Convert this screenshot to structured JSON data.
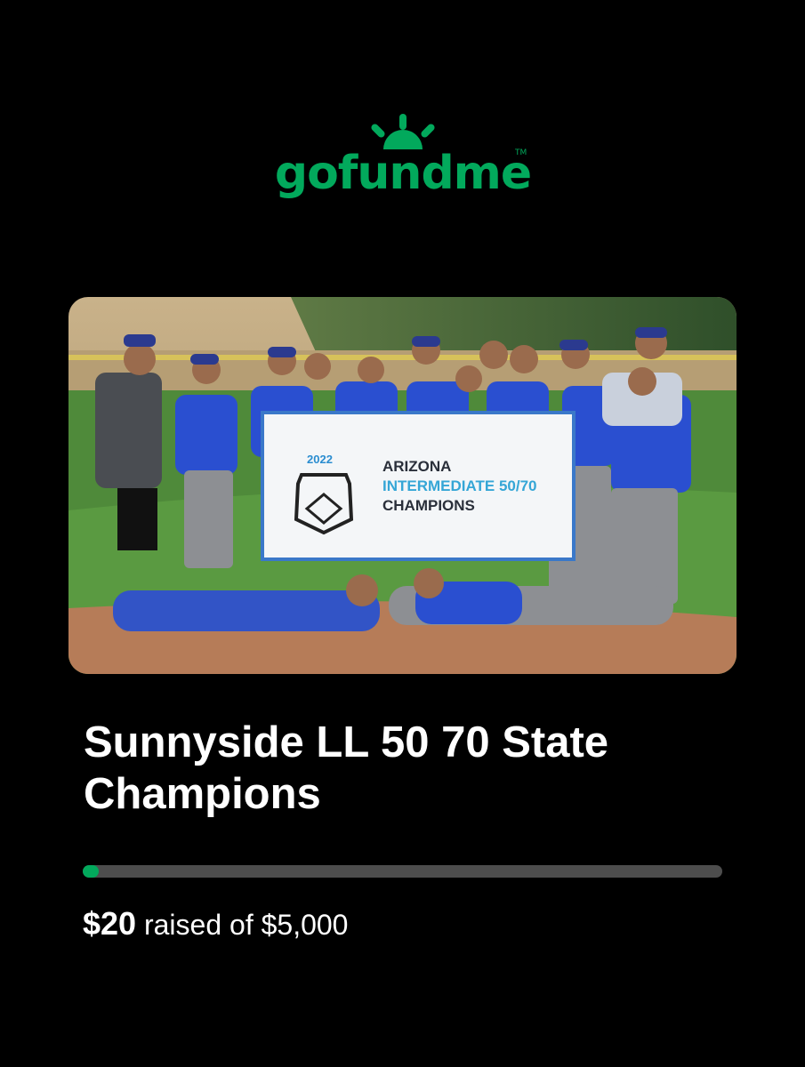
{
  "brand": {
    "name": "gofundme",
    "trademark": "TM",
    "color": "#02a95c"
  },
  "photo": {
    "icon": "team-photo-image",
    "banner": {
      "year": "2022",
      "line1": "ARIZONA",
      "line2": "INTERMEDIATE 50/70",
      "line3": "CHAMPIONS"
    }
  },
  "campaign": {
    "title": "Sunnyside LL 50 70 State Champions",
    "raised": "$20",
    "goal_text": "raised of $5,000",
    "progress_fraction": 0.004
  },
  "colors": {
    "background": "#000000",
    "progress_track": "#4d4d4d",
    "progress_fill": "#02a95c"
  }
}
